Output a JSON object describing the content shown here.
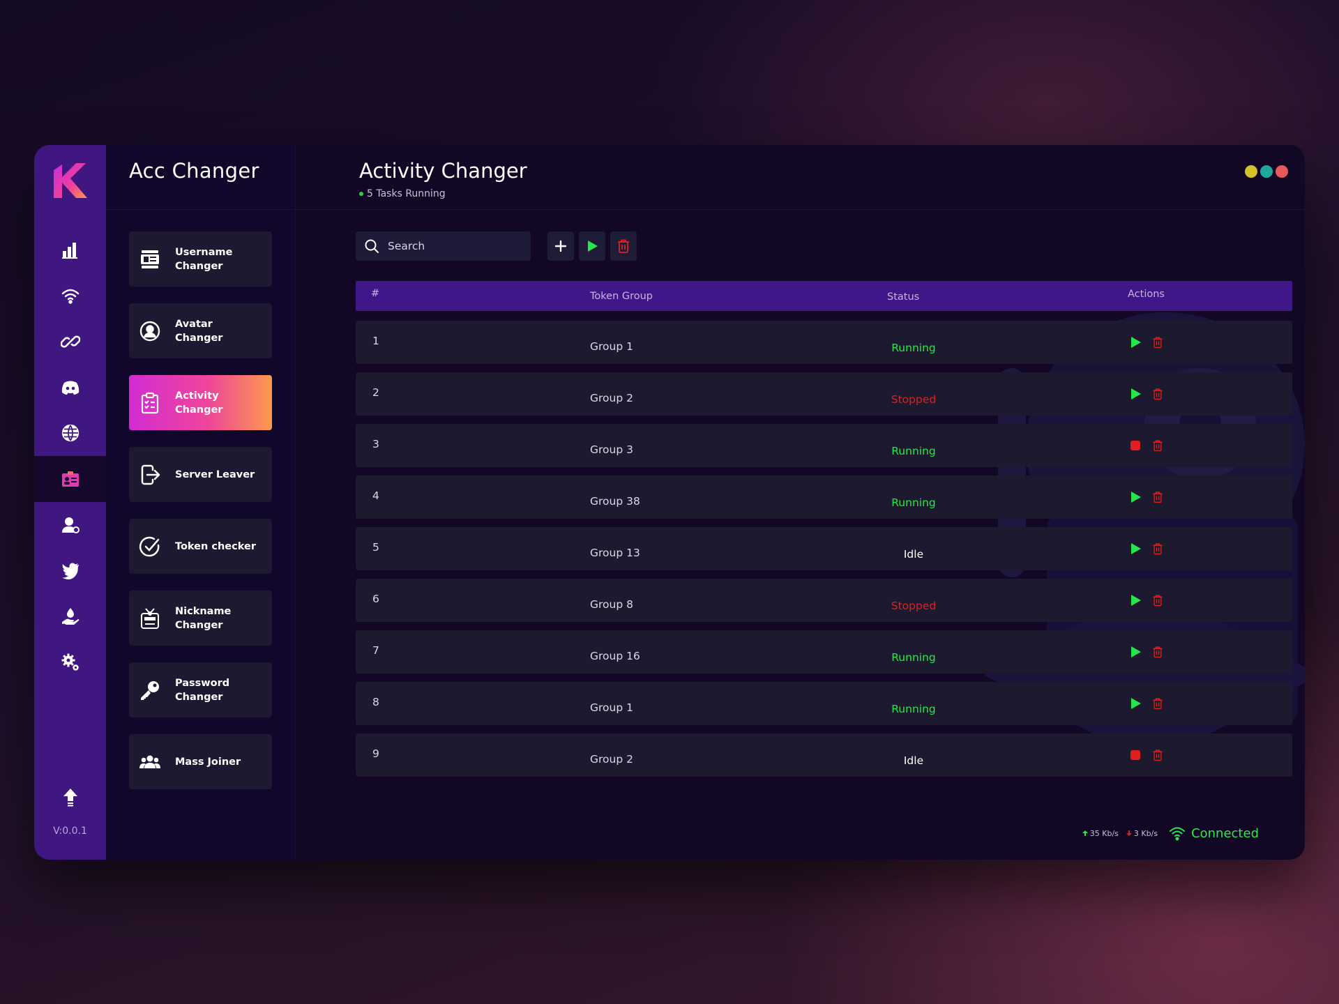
{
  "app": {
    "title": "Acc Changer",
    "version": "V:0.0.1"
  },
  "rail": {
    "items": [
      {
        "icon": "dashboard-icon"
      },
      {
        "icon": "wifi-icon"
      },
      {
        "icon": "link-icon"
      },
      {
        "icon": "discord-icon"
      },
      {
        "icon": "globe-icon"
      },
      {
        "icon": "id-card-icon"
      },
      {
        "icon": "user-pin-icon"
      },
      {
        "icon": "twitter-icon"
      },
      {
        "icon": "hand-drop-icon"
      },
      {
        "icon": "settings-gears-icon"
      }
    ],
    "active_index": 5,
    "footer_icon": "upload-arrow-icon"
  },
  "tools": [
    {
      "label": "Username Changer",
      "icon": "id-badge-icon"
    },
    {
      "label": "Avatar Changer",
      "icon": "user-circle-icon"
    },
    {
      "label": "Activity Changer",
      "icon": "clipboard-list-icon"
    },
    {
      "label": "Server Leaver",
      "icon": "exit-icon"
    },
    {
      "label": "Token checker",
      "icon": "check-circle-icon"
    },
    {
      "label": "Nickname Changer",
      "icon": "name-tag-icon"
    },
    {
      "label": "Password Changer",
      "icon": "key-icon"
    },
    {
      "label": "Mass Joiner",
      "icon": "group-icon"
    }
  ],
  "active_tool_index": 2,
  "page": {
    "title": "Activity Changer",
    "subtitle": "5 Tasks Running"
  },
  "search": {
    "placeholder": "Search"
  },
  "table": {
    "headers": {
      "num": "#",
      "group": "Token Group",
      "status": "Status",
      "actions": "Actions"
    },
    "rows": [
      {
        "num": "1",
        "group": "Group 1",
        "status": "Running",
        "action": "play"
      },
      {
        "num": "2",
        "group": "Group 2",
        "status": "Stopped",
        "action": "play"
      },
      {
        "num": "3",
        "group": "Group 3",
        "status": "Running",
        "action": "stop"
      },
      {
        "num": "4",
        "group": "Group 38",
        "status": "Running",
        "action": "play"
      },
      {
        "num": "5",
        "group": "Group 13",
        "status": "Idle",
        "action": "play"
      },
      {
        "num": "6",
        "group": "Group 8",
        "status": "Stopped",
        "action": "play"
      },
      {
        "num": "7",
        "group": "Group 16",
        "status": "Running",
        "action": "play"
      },
      {
        "num": "8",
        "group": "Group 1",
        "status": "Running",
        "action": "play"
      },
      {
        "num": "9",
        "group": "Group 2",
        "status": "Idle",
        "action": "stop"
      }
    ]
  },
  "status_bar": {
    "upload": "35 Kb/s",
    "download": "3 Kb/s",
    "connection": "Connected"
  },
  "colors": {
    "accent": "#401781",
    "running": "#27e64a",
    "stopped": "#e0201f",
    "window_dots": [
      "#d4c22a",
      "#1ea79c",
      "#e85a5a"
    ]
  }
}
